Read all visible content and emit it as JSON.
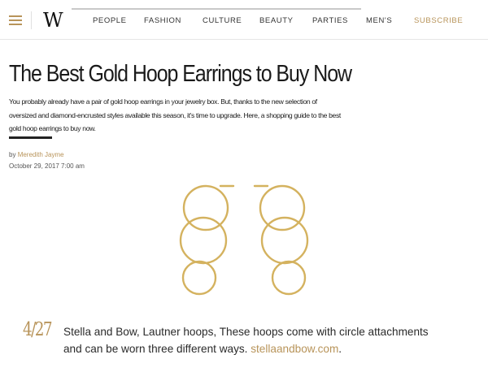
{
  "header": {
    "logo_text": "W",
    "nav_items": [
      {
        "label": "PEOPLE"
      },
      {
        "label": "FASHION"
      },
      {
        "label": "CULTURE"
      },
      {
        "label": "BEAUTY"
      },
      {
        "label": "PARTIES"
      },
      {
        "label": "MEN'S"
      }
    ],
    "subscribe_label": "SUBSCRIBE"
  },
  "article": {
    "title": "The Best Gold Hoop Earrings to Buy Now",
    "dek": "You probably already have a pair of gold hoop earrings in your jewelry box. But, thanks to the new selection of oversized and diamond-encrusted styles available this season, it's time to upgrade. Here, a shopping guide to the best gold hoop earrings to buy now.",
    "by_prefix": "by",
    "author": "Meredith Jayme",
    "date": "October 29, 2017 7:00 am"
  },
  "slide": {
    "counter": "4/27",
    "caption_text": "Stella and Bow, Lautner hoops, These hoops come with circle attachments and can be worn three different ways.",
    "link_text": "stellaandbow.com",
    "suffix": "."
  },
  "colors": {
    "accent_gold": "#b8945a",
    "earring_gold": "#d4b25f",
    "text": "#1a1a1a"
  },
  "icons": {
    "menu": "hamburger-menu-icon",
    "product_image": "gold-hoop-earrings-image"
  }
}
